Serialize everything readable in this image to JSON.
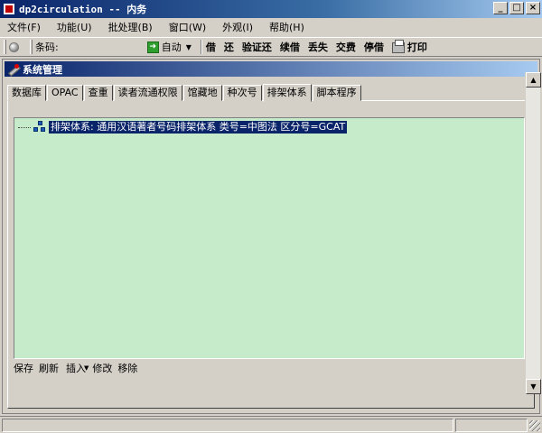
{
  "window": {
    "title": "dp2circulation -- 内务",
    "minimize_glyph": "_",
    "maximize_glyph": "□",
    "close_glyph": "×"
  },
  "menu": [
    "文件(F)",
    "功能(U)",
    "批处理(B)",
    "窗口(W)",
    "外观(I)",
    "帮助(H)"
  ],
  "toolbar": {
    "barcode_label": "条码:",
    "barcode_value": "",
    "auto_label": "自动",
    "buttons": [
      "借",
      "还",
      "验证还",
      "续借",
      "丢失",
      "交费",
      "停借"
    ],
    "print_label": "打印"
  },
  "child_window": {
    "title": "系统管理"
  },
  "tabs": [
    "数据库",
    "OPAC",
    "查重",
    "读者流通权限",
    "馆藏地",
    "种次号",
    "排架体系",
    "脚本程序"
  ],
  "active_tab": "排架体系",
  "tree": {
    "items": [
      {
        "label": "排架体系: 通用汉语著者号码排架体系  类号=中图法  区分号=GCAT",
        "selected": true
      }
    ],
    "background": "#c6ebcb"
  },
  "actions": {
    "save": "保存",
    "refresh": "刷新",
    "insert": "插入",
    "modify": "修改",
    "remove": "移除"
  },
  "colors": {
    "title_bar": "#0a246a",
    "selection": "#0a246a",
    "tree_background": "#c6ebcb"
  }
}
